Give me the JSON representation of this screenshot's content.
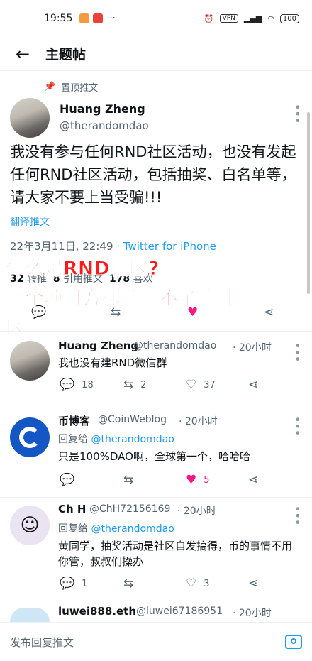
{
  "status": {
    "time": "19:55",
    "extra": "···",
    "vpn": "VPN",
    "battery": "100"
  },
  "header": {
    "back_icon": "←",
    "title": "主题帖"
  },
  "pinned": {
    "label": "置顶推文"
  },
  "main_tweet": {
    "name": "Huang Zheng",
    "handle": "@therandomdao",
    "text": "我没有参与任何RND社区活动，也没有发起任何RND社区活动，包括抽奖、白名单等，请大家不要上当受骗!!!",
    "translate": "翻译推文",
    "date": "22年3月11日, 22:49 · ",
    "source": "Twitter for iPhone",
    "stats": {
      "retweets": "32",
      "retweets_label": "转推",
      "quotes": "8",
      "quotes_label": "引用推文",
      "likes": "178",
      "likes_label": "喜欢"
    }
  },
  "overlay": {
    "line1": "什么是RND社区?",
    "line2": "一个项目方都控制不了的社",
    "line3": "区"
  },
  "replies": [
    {
      "name": "Huang Zheng",
      "handle": "@therandomdao",
      "time": "· 20小时",
      "text": "我也没有建RND微信群",
      "reply": "18",
      "retweet": "2",
      "like": "37"
    },
    {
      "name": "币博客",
      "handle": "@CoinWeblog",
      "time": "· 20小时",
      "reply_to_label": "回复给 ",
      "reply_to": "@therandomdao",
      "text": "只是100%DAO啊，全球第一个，哈哈哈",
      "like": "5"
    },
    {
      "name": "Ch H",
      "handle": "@ChH72156169",
      "time": "· 20小时",
      "reply_to_label": "回复给 ",
      "reply_to": "@therandomdao",
      "text": "黄同学，抽奖活动是社区自发搞得，币的事情不用你管，叔叔们操办",
      "reply": "1",
      "like": "3"
    },
    {
      "name": "luwei888.eth",
      "handle": "@luwei67186951",
      "time": "· 20小时"
    }
  ],
  "compose": {
    "placeholder": "发布回复推文"
  },
  "icons": {
    "reply": "reply-icon",
    "retweet": "retweet-icon",
    "like": "heart-icon",
    "share": "share-icon",
    "more": "more-icon"
  }
}
